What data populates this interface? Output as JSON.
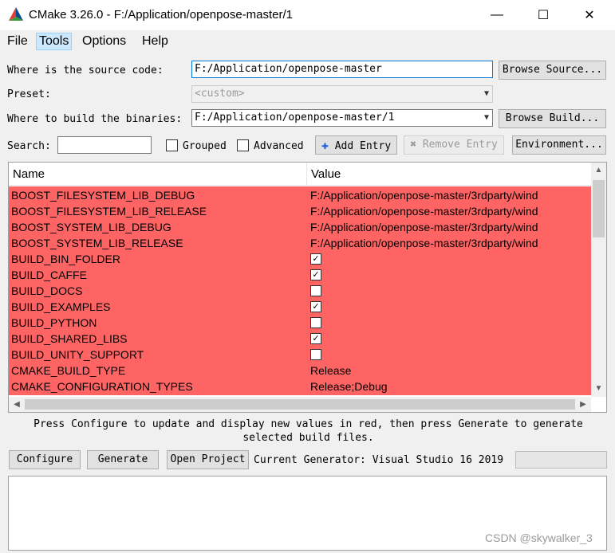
{
  "window": {
    "title": "CMake 3.26.0 - F:/Application/openpose-master/1",
    "minimize_glyph": "—",
    "maximize_glyph": "☐",
    "close_glyph": "✕",
    "logo_icon": "cmake-triangle-icon"
  },
  "menu": [
    {
      "label": "File",
      "active": false
    },
    {
      "label": "Tools",
      "active": true
    },
    {
      "label": "Options",
      "active": false
    },
    {
      "label": "Help",
      "active": false
    }
  ],
  "source": {
    "label": "Where is the source code:",
    "value": "F:/Application/openpose-master",
    "browse_button": "Browse Source..."
  },
  "preset": {
    "label": "Preset:",
    "value": "<custom>"
  },
  "binaries": {
    "label": "Where to build the binaries:",
    "value": "F:/Application/openpose-master/1",
    "browse_button": "Browse Build..."
  },
  "search": {
    "label": "Search:",
    "value": "",
    "grouped_label": "Grouped",
    "grouped_checked": false,
    "advanced_label": "Advanced",
    "advanced_checked": false,
    "add_entry": "Add Entry",
    "remove_entry": "Remove Entry",
    "environment": "Environment..."
  },
  "table": {
    "headers": [
      "Name",
      "Value"
    ],
    "row_color": "#ff6464",
    "rows": [
      {
        "name": "BOOST_FILESYSTEM_LIB_DEBUG",
        "type": "text",
        "value": "F:/Application/openpose-master/3rdparty/wind"
      },
      {
        "name": "BOOST_FILESYSTEM_LIB_RELEASE",
        "type": "text",
        "value": "F:/Application/openpose-master/3rdparty/wind"
      },
      {
        "name": "BOOST_SYSTEM_LIB_DEBUG",
        "type": "text",
        "value": "F:/Application/openpose-master/3rdparty/wind"
      },
      {
        "name": "BOOST_SYSTEM_LIB_RELEASE",
        "type": "text",
        "value": "F:/Application/openpose-master/3rdparty/wind"
      },
      {
        "name": "BUILD_BIN_FOLDER",
        "type": "bool",
        "value": true
      },
      {
        "name": "BUILD_CAFFE",
        "type": "bool",
        "value": true
      },
      {
        "name": "BUILD_DOCS",
        "type": "bool",
        "value": false
      },
      {
        "name": "BUILD_EXAMPLES",
        "type": "bool",
        "value": true
      },
      {
        "name": "BUILD_PYTHON",
        "type": "bool",
        "value": false
      },
      {
        "name": "BUILD_SHARED_LIBS",
        "type": "bool",
        "value": true
      },
      {
        "name": "BUILD_UNITY_SUPPORT",
        "type": "bool",
        "value": false
      },
      {
        "name": "CMAKE_BUILD_TYPE",
        "type": "text",
        "value": "Release"
      },
      {
        "name": "CMAKE_CONFIGURATION_TYPES",
        "type": "text",
        "value": "Release;Debug"
      }
    ]
  },
  "info_text": "Press Configure to update and display new values in red, then press Generate to generate selected build files.",
  "actions": {
    "configure": "Configure",
    "generate": "Generate",
    "open_project": "Open Project",
    "current_generator": "Current Generator: Visual Studio 16 2019"
  },
  "watermark": "CSDN @skywalker_3"
}
